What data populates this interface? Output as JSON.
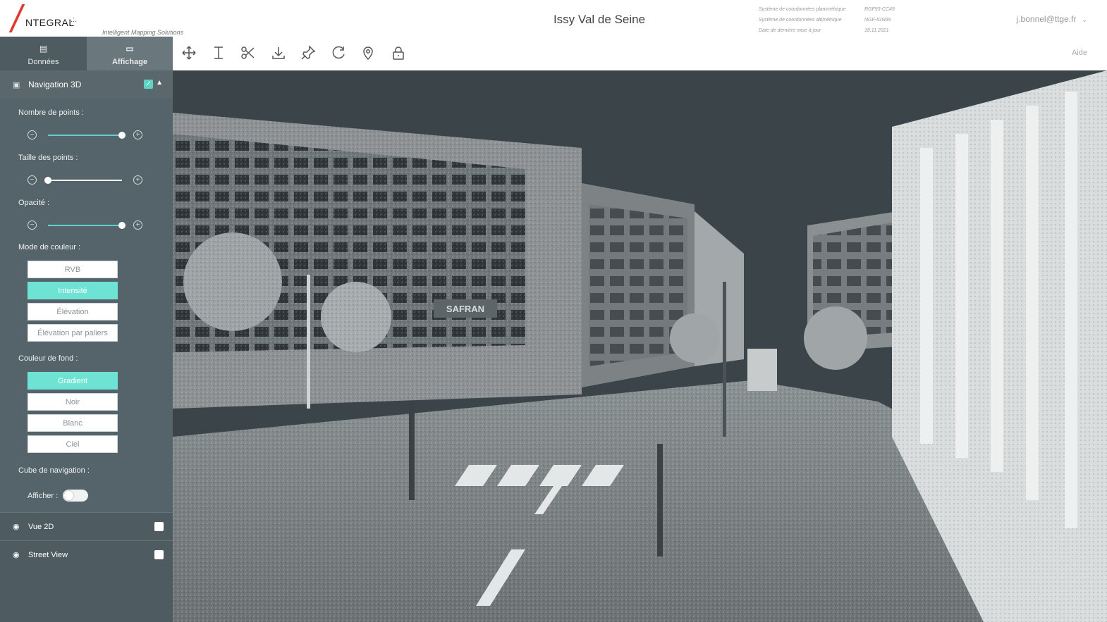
{
  "brand": {
    "wordmark": "NTEGRAL",
    "mark": ".:.",
    "tagline": "Intelligent Mapping Solutions",
    "accent_color": "#e03a2f"
  },
  "header": {
    "title": "Issy Val de Seine",
    "meta": [
      {
        "label": "Système de coordonnées planimétrique",
        "value": "RGF93-CC49"
      },
      {
        "label": "Système de coordonnées altimétrique",
        "value": "NGF-IGN69"
      },
      {
        "label": "Date de dernière mise à jour",
        "value": "18.11.2021"
      }
    ],
    "user": "j.bonnel@ttge.fr"
  },
  "sidebar": {
    "tabs": [
      {
        "label": "Données",
        "icon": "document-icon",
        "active": false
      },
      {
        "label": "Affichage",
        "icon": "monitor-icon",
        "active": true
      }
    ],
    "navigation": {
      "label": "Navigation 3D",
      "checked": true,
      "points_count_label": "Nombre de points :",
      "points_count_level": 1.0,
      "point_size_label": "Taille des points :",
      "point_size_level": 0.0,
      "opacity_label": "Opacité :",
      "opacity_level": 1.0,
      "color_mode_label": "Mode de couleur :",
      "color_modes": [
        "RVB",
        "Intensité",
        "Élévation",
        "Élévation par paliers"
      ],
      "color_mode_selected": "Intensité",
      "background_label": "Couleur de fond :",
      "backgrounds": [
        "Gradient",
        "Noir",
        "Blanc",
        "Ciel"
      ],
      "background_selected": "Gradient",
      "cube_label": "Cube de navigation :",
      "show_label": "Afficher :",
      "show_on": false
    },
    "vue2d": {
      "label": "Vue 2D",
      "checked": false
    },
    "streetview": {
      "label": "Street View",
      "checked": false
    },
    "accent_color": "#6ee3d4"
  },
  "toolbar": {
    "tools": [
      "move-icon",
      "height-measure-icon",
      "scissors-icon",
      "download-icon",
      "pin-icon",
      "reset-view-icon",
      "location-icon",
      "lock-icon"
    ],
    "help_label": "Aide"
  },
  "viewer": {
    "sign_text": "SAFRAN",
    "description_colors": {
      "sky": "#3a4449",
      "ground": "#7d8587"
    }
  }
}
